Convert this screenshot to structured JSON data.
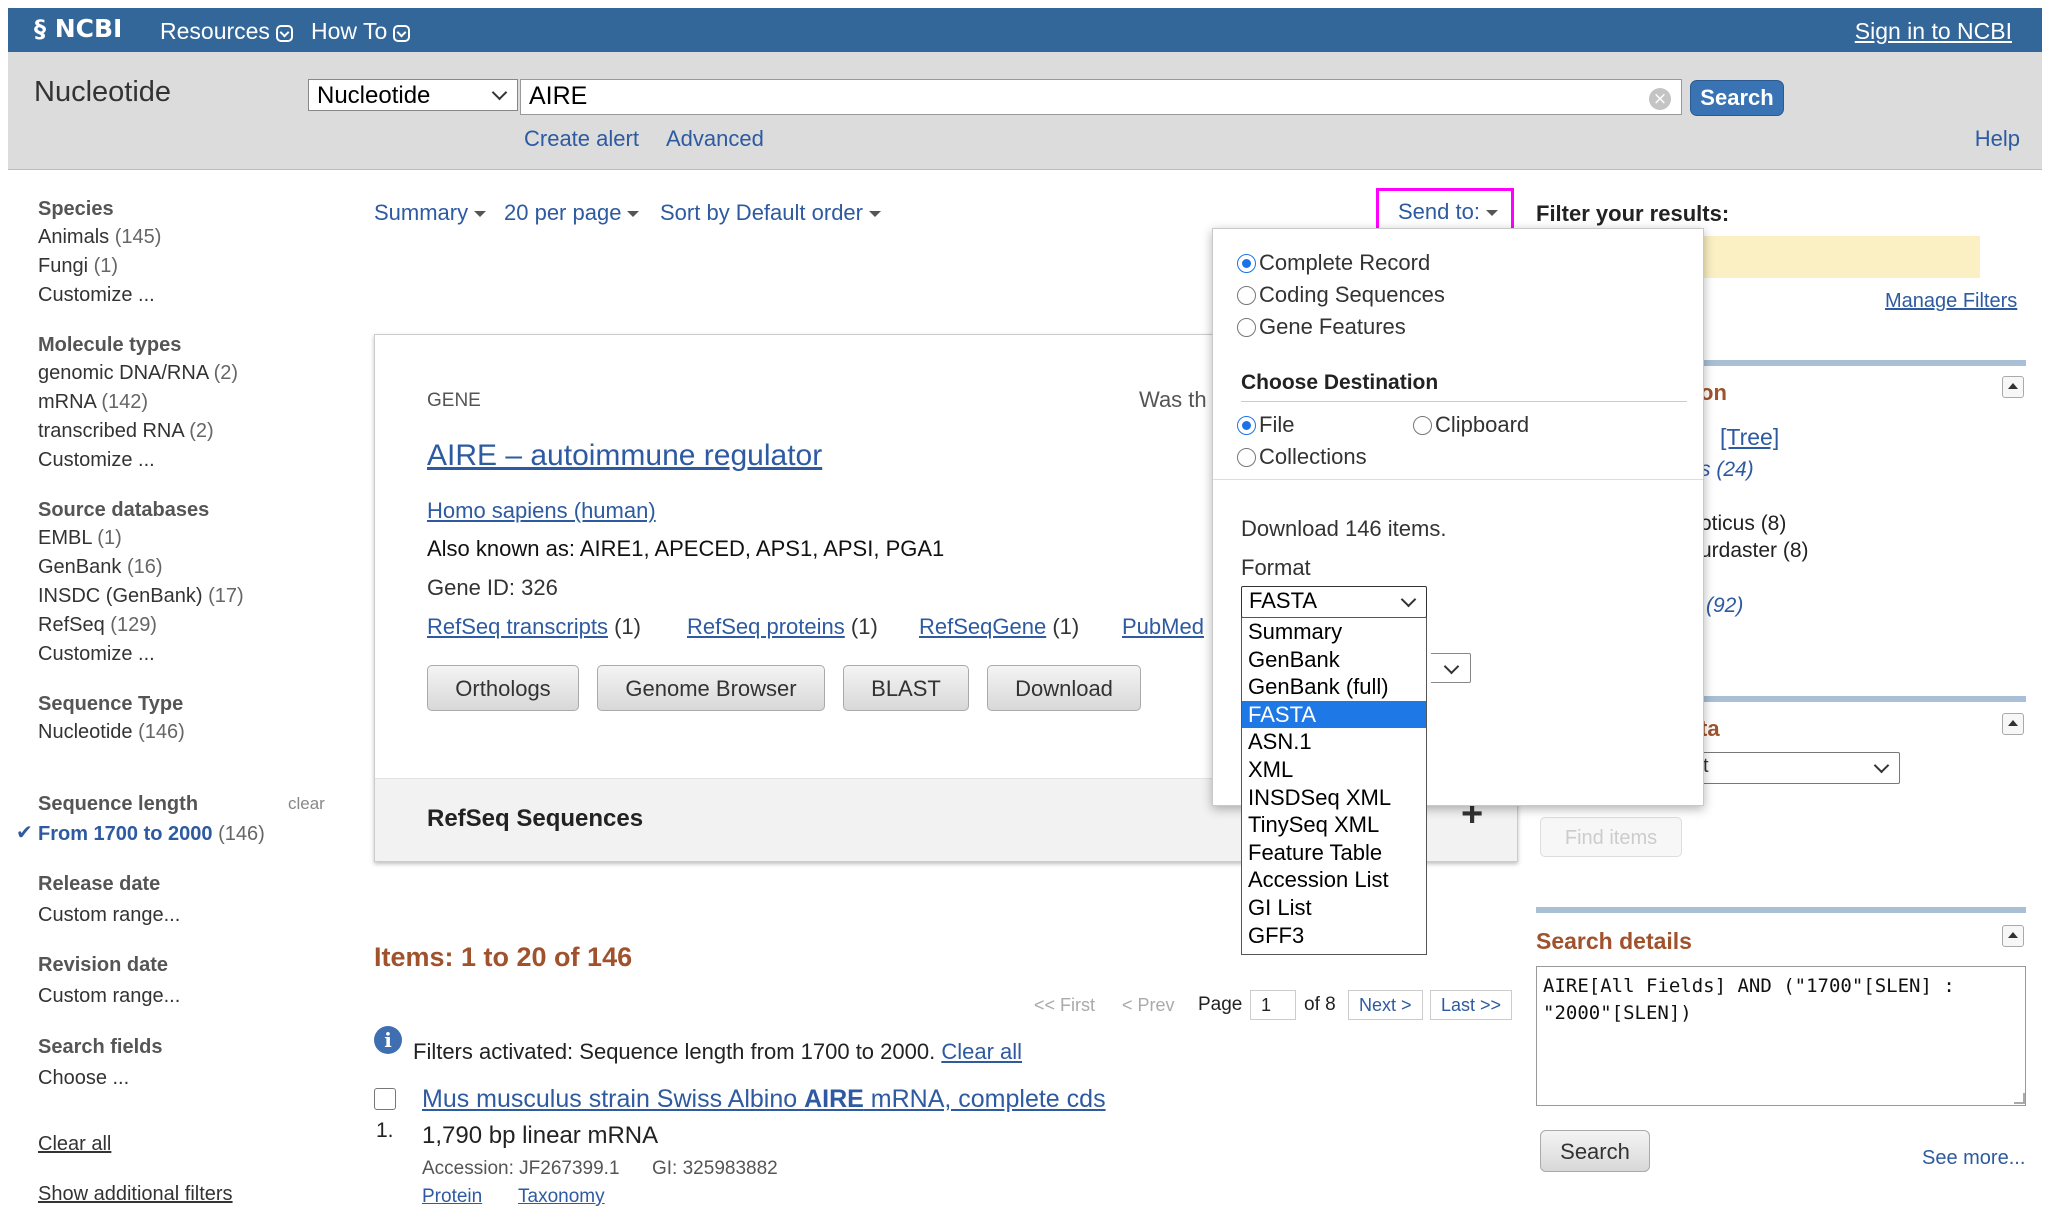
{
  "topbar": {
    "logo": "NCBI",
    "resources": "Resources",
    "howto": "How To",
    "signin": "Sign in to NCBI"
  },
  "searchbar": {
    "db_title": "Nucleotide",
    "db_select": "Nucleotide",
    "term": "AIRE",
    "search_btn": "Search",
    "create_alert": "Create alert",
    "advanced": "Advanced",
    "help": "Help"
  },
  "sidebar": {
    "species": {
      "header": "Species",
      "items": [
        [
          "Animals",
          "(145)"
        ],
        [
          "Fungi",
          "(1)"
        ]
      ],
      "customize": "Customize ..."
    },
    "molecule": {
      "header": "Molecule types",
      "items": [
        [
          "genomic DNA/RNA",
          "(2)"
        ],
        [
          "mRNA",
          "(142)"
        ],
        [
          "transcribed RNA",
          "(2)"
        ]
      ],
      "customize": "Customize ..."
    },
    "source": {
      "header": "Source databases",
      "items": [
        [
          "EMBL",
          "(1)"
        ],
        [
          "GenBank",
          "(16)"
        ],
        [
          "INSDC (GenBank)",
          "(17)"
        ],
        [
          "RefSeq",
          "(129)"
        ]
      ],
      "customize": "Customize ..."
    },
    "seqtype": {
      "header": "Sequence Type",
      "items": [
        [
          "Nucleotide",
          "(146)"
        ]
      ]
    },
    "seqlen": {
      "header": "Sequence length",
      "clear": "clear",
      "active": "From 1700 to 2000",
      "active_count": "(146)"
    },
    "release": {
      "header": "Release date",
      "item": "Custom range..."
    },
    "revision": {
      "header": "Revision date",
      "item": "Custom range..."
    },
    "fields": {
      "header": "Search fields",
      "item": "Choose ..."
    },
    "clear_all": "Clear all",
    "show_filters": "Show additional filters"
  },
  "controls": {
    "summary": "Summary",
    "per_page": "20 per page",
    "sort": "Sort by Default order",
    "send_to": "Send to:"
  },
  "gene": {
    "label": "GENE",
    "was_this": "Was th",
    "title": "AIRE – autoimmune regulator",
    "organism": "Homo sapiens (human)",
    "aka": "Also known as: AIRE1, APECED, APS1, APSI, PGA1",
    "gene_id": "Gene ID: 326",
    "links": [
      {
        "text": "RefSeq transcripts",
        "count": "(1)"
      },
      {
        "text": "RefSeq proteins",
        "count": "(1)"
      },
      {
        "text": "RefSeqGene",
        "count": "(1)"
      },
      {
        "text": "PubMed",
        "count": ""
      }
    ],
    "buttons": [
      "Orthologs",
      "Genome Browser",
      "BLAST",
      "Download"
    ],
    "refseq_header": "RefSeq Sequences",
    "plus": "+"
  },
  "results": {
    "items_header": "Items: 1 to 20 of 146",
    "first": "<< First",
    "prev": "< Prev",
    "page_label": "Page",
    "page_value": "1",
    "of_pages": "of 8",
    "next": "Next >",
    "last": "Last >>",
    "filters_text": "Filters activated: Sequence length from 1700 to 2000.",
    "clear_all": "Clear all",
    "item1": {
      "number": "1.",
      "title_pre": "Mus musculus strain Swiss Albino ",
      "title_bold": "AIRE",
      "title_post": " mRNA, complete cds",
      "desc": "1,790 bp linear mRNA",
      "accession": "Accession: JF267399.1",
      "gi": "GI: 325983882",
      "protein": "Protein",
      "taxonomy": "Taxonomy"
    }
  },
  "sendto_panel": {
    "options": [
      "Complete Record",
      "Coding Sequences",
      "Gene Features"
    ],
    "choose_dest": "Choose Destination",
    "dest_file": "File",
    "dest_clipboard": "Clipboard",
    "dest_collections": "Collections",
    "download_text": "Download 146 items.",
    "format_label": "Format",
    "format_selected": "FASTA",
    "format_options": [
      "Summary",
      "GenBank",
      "GenBank (full)",
      "FASTA",
      "ASN.1",
      "XML",
      "INSDSeq XML",
      "TinySeq XML",
      "Feature Table",
      "Accession List",
      "GI List",
      "GFF3"
    ]
  },
  "right": {
    "filter_title": "Filter your results:",
    "manage_filters": "Manage Filters",
    "taxon_frag": "on",
    "tree": "[Tree]",
    "frag_24": "s (24)",
    "frag_oticus": "oticus (8)",
    "frag_urdaster": "urdaster (8)",
    "frag_92": "(92)",
    "frag_ta": "ta",
    "frag_t": "t",
    "find_items": "Find items",
    "search_details_title": "Search details",
    "query": "AIRE[All Fields] AND (\"1700\"[SLEN] : \"2000\"[SLEN])",
    "search_btn": "Search",
    "see_more": "See more..."
  },
  "colors": {
    "ncbi_blue": "#336699",
    "link_blue": "#2d5aa0",
    "items_brown": "#a0522d",
    "highlight_magenta": "#ff00ff",
    "selected_option": "#1e78e6",
    "filter_yellow": "#fbf0c4"
  }
}
